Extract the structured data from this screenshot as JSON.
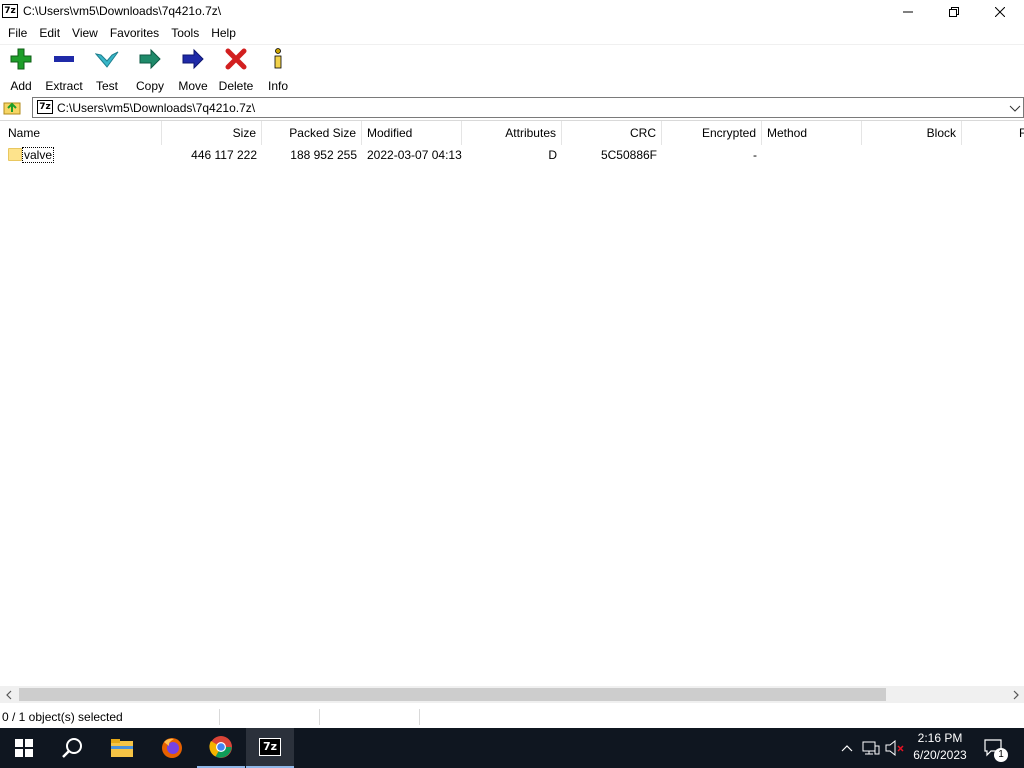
{
  "window": {
    "title": "C:\\Users\\vm5\\Downloads\\7q421o.7z\\",
    "app_icon_text": "7z"
  },
  "menu": [
    "File",
    "Edit",
    "View",
    "Favorites",
    "Tools",
    "Help"
  ],
  "toolbar": {
    "add": "Add",
    "extract": "Extract",
    "test": "Test",
    "copy": "Copy",
    "move": "Move",
    "delete": "Delete",
    "info": "Info"
  },
  "address": {
    "path": "C:\\Users\\vm5\\Downloads\\7q421o.7z\\"
  },
  "columns": {
    "name": "Name",
    "size": "Size",
    "packed_size": "Packed Size",
    "modified": "Modified",
    "attributes": "Attributes",
    "crc": "CRC",
    "encrypted": "Encrypted",
    "method": "Method",
    "block": "Block",
    "extra": "F"
  },
  "rows": [
    {
      "name": "valve",
      "size": "446 117 222",
      "packed_size": "188 952 255",
      "modified": "2022-03-07 04:13",
      "attributes": "D",
      "crc": "5C50886F",
      "encrypted": "-",
      "method": "",
      "block": ""
    }
  ],
  "status": {
    "selection": "0 / 1 object(s) selected"
  },
  "taskbar": {
    "active_app_label": "7z"
  },
  "clock": {
    "time": "2:16 PM",
    "date": "6/20/2023"
  },
  "notification_count": "1",
  "colors": {
    "taskbar_bg": "#0f1620",
    "add_green": "#1e9e2a",
    "extract_blue": "#1f2aa8",
    "test_cyan": "#38b6c8",
    "delete_red": "#d21f1f",
    "folder_yellow": "#fde38c"
  }
}
